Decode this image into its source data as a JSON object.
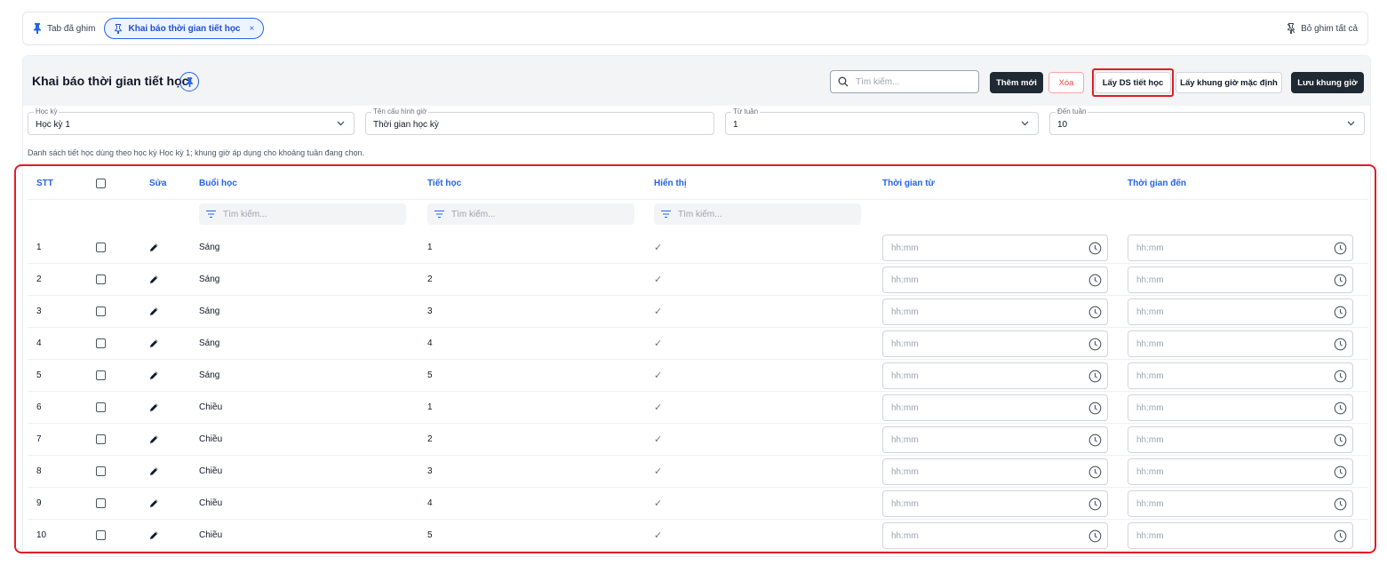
{
  "pinbar": {
    "label": "Tab đã ghim",
    "active_tab": "Khai báo thời gian tiết học",
    "close": "×",
    "unpin_all": "Bỏ ghim tất cả"
  },
  "header": {
    "title": "Khai báo thời gian tiết học",
    "search_placeholder": "Tìm kiếm...",
    "buttons": {
      "add": "Thêm mới",
      "delete": "Xóa",
      "get_list": "Lấy DS tiết học",
      "get_default": "Lấy khung giờ mặc định",
      "save": "Lưu khung giờ"
    }
  },
  "filters": {
    "semester": {
      "label": "Học kỳ",
      "value": "Học kỳ 1"
    },
    "config_name": {
      "label": "Tên cấu hình giờ",
      "value": "Thời gian học kỳ"
    },
    "from_week": {
      "label": "Từ tuần",
      "value": "1"
    },
    "to_week": {
      "label": "Đến tuần",
      "value": "10"
    }
  },
  "hint": "Danh sách tiết học dùng theo học kỳ Học kỳ 1; khung giờ áp dụng cho khoảng tuần đang chọn.",
  "table": {
    "columns": {
      "stt": "STT",
      "edit": "Sửa",
      "session": "Buổi học",
      "period": "Tiết học",
      "display": "Hiển thị",
      "time_from": "Thời gian từ",
      "time_to": "Thời gian đến"
    },
    "filter_placeholder": "Tìm kiếm...",
    "time_placeholder": "hh:mm",
    "check_mark": "✓",
    "rows": [
      {
        "stt": "1",
        "session": "Sáng",
        "period": "1"
      },
      {
        "stt": "2",
        "session": "Sáng",
        "period": "2"
      },
      {
        "stt": "3",
        "session": "Sáng",
        "period": "3"
      },
      {
        "stt": "4",
        "session": "Sáng",
        "period": "4"
      },
      {
        "stt": "5",
        "session": "Sáng",
        "period": "5"
      },
      {
        "stt": "6",
        "session": "Chiều",
        "period": "1"
      },
      {
        "stt": "7",
        "session": "Chiều",
        "period": "2"
      },
      {
        "stt": "8",
        "session": "Chiều",
        "period": "3"
      },
      {
        "stt": "9",
        "session": "Chiều",
        "period": "4"
      },
      {
        "stt": "10",
        "session": "Chiều",
        "period": "5"
      }
    ]
  }
}
